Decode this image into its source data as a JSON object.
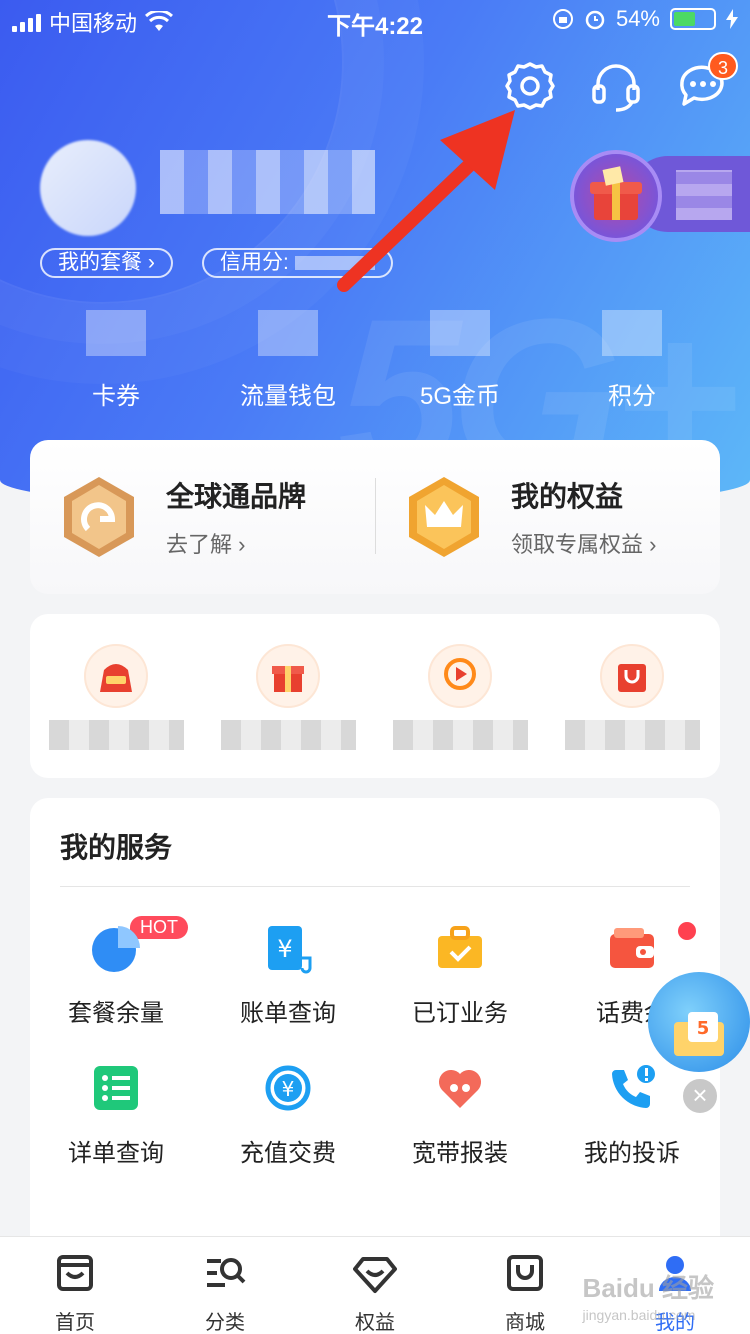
{
  "status_bar": {
    "carrier": "中国移动",
    "time": "下午4:22",
    "battery": "54%"
  },
  "header": {
    "icons": [
      "settings-icon",
      "customer-service-icon",
      "message-icon"
    ],
    "message_badge": "3",
    "links": {
      "plan": "我的套餐 ›",
      "credit": "信用分:"
    },
    "stats": [
      "卡券",
      "流量钱包",
      "5G金币",
      "积分"
    ]
  },
  "brand": {
    "left": {
      "title": "全球通品牌",
      "sub": "去了解 ›"
    },
    "right": {
      "title": "我的权益",
      "sub": "领取专属权益 ›"
    }
  },
  "services": {
    "title": "我的服务",
    "hot": "HOT",
    "items": [
      "套餐余量",
      "账单查询",
      "已订业务",
      "话费余",
      "详单查询",
      "充值交费",
      "宽带报装",
      "我的投诉"
    ]
  },
  "tabbar": [
    "首页",
    "分类",
    "权益",
    "商城",
    "我的"
  ],
  "watermark": {
    "brand": "Baidu 经验",
    "url": "jingyan.baidu.com"
  },
  "colors": {
    "primary": "#3b5bf0",
    "accent": "#ff5a1f",
    "active_tab": "#2f6df5"
  }
}
